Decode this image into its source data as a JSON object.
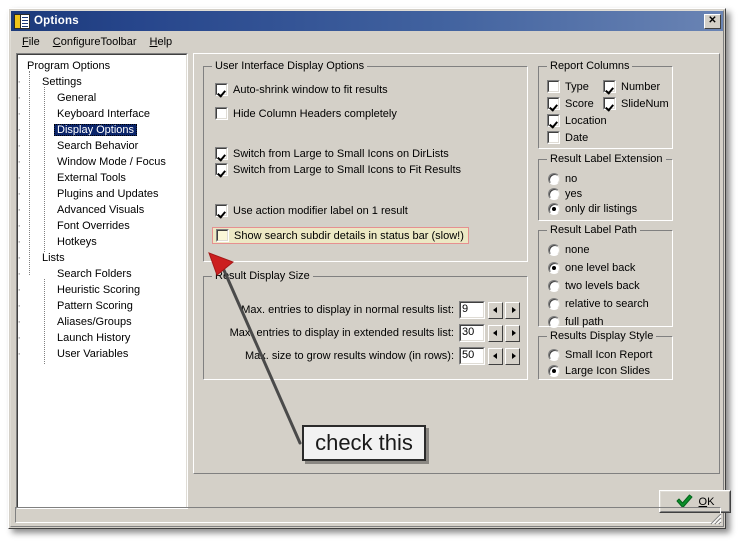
{
  "window": {
    "title": "Options",
    "icon": "options-checklist-icon",
    "close_label": "✕"
  },
  "menubar": {
    "items": [
      {
        "label": "File",
        "mnemonic": "F"
      },
      {
        "label": "ConfigureToolbar",
        "mnemonic": "C"
      },
      {
        "label": "Help",
        "mnemonic": "H"
      }
    ]
  },
  "tree": {
    "nodes": [
      {
        "label": "Program Options",
        "level": 0,
        "selected": false
      },
      {
        "label": "Settings",
        "level": 1,
        "selected": false
      },
      {
        "label": "General",
        "level": 2,
        "selected": false
      },
      {
        "label": "Keyboard Interface",
        "level": 2,
        "selected": false
      },
      {
        "label": "Display Options",
        "level": 2,
        "selected": true
      },
      {
        "label": "Search Behavior",
        "level": 2,
        "selected": false
      },
      {
        "label": "Window Mode / Focus",
        "level": 2,
        "selected": false
      },
      {
        "label": "External Tools",
        "level": 2,
        "selected": false
      },
      {
        "label": "Plugins and Updates",
        "level": 2,
        "selected": false
      },
      {
        "label": "Advanced Visuals",
        "level": 2,
        "selected": false
      },
      {
        "label": "Font Overrides",
        "level": 2,
        "selected": false
      },
      {
        "label": "Hotkeys",
        "level": 2,
        "selected": false
      },
      {
        "label": "Lists",
        "level": 1,
        "selected": false
      },
      {
        "label": "Search Folders",
        "level": 2,
        "selected": false
      },
      {
        "label": "Heuristic Scoring",
        "level": 2,
        "selected": false
      },
      {
        "label": "Pattern Scoring",
        "level": 2,
        "selected": false
      },
      {
        "label": "Aliases/Groups",
        "level": 2,
        "selected": false
      },
      {
        "label": "Launch History",
        "level": 2,
        "selected": false
      },
      {
        "label": "User Variables",
        "level": 2,
        "selected": false
      }
    ]
  },
  "ui_display_options": {
    "title": "User Interface Display Options",
    "checkboxes": [
      {
        "label": "Auto-shrink window to fit results",
        "checked": true
      },
      {
        "label": "Hide Column Headers completely",
        "checked": false
      },
      {
        "label": "Switch from Large to Small Icons on DirLists",
        "checked": true
      },
      {
        "label": "Switch from Large to Small Icons to Fit Results",
        "checked": true
      },
      {
        "label": "Use action modifier label on 1 result",
        "checked": true
      },
      {
        "label": "Show search subdir details in status bar (slow!)",
        "checked": false
      }
    ]
  },
  "result_display_size": {
    "title": "Result Display Size",
    "rows": [
      {
        "label": "Max. entries to display in normal results list:",
        "value": "9"
      },
      {
        "label": "Max. entries to display in extended results list:",
        "value": "30"
      },
      {
        "label": "Max. size to grow results window (in rows):",
        "value": "50"
      }
    ]
  },
  "report_columns": {
    "title": "Report Columns",
    "checkboxes": [
      {
        "label": "Type",
        "checked": false
      },
      {
        "label": "Number",
        "checked": true
      },
      {
        "label": "Score",
        "checked": true
      },
      {
        "label": "SlideNum",
        "checked": true
      },
      {
        "label": "Location",
        "checked": true
      },
      {
        "label": "Date",
        "checked": false
      }
    ]
  },
  "result_label_extension": {
    "title": "Result Label Extension",
    "options": [
      {
        "label": "no",
        "selected": false
      },
      {
        "label": "yes",
        "selected": false
      },
      {
        "label": "only dir listings",
        "selected": true
      }
    ]
  },
  "result_label_path": {
    "title": "Result Label Path",
    "options": [
      {
        "label": "none",
        "selected": false
      },
      {
        "label": "one level back",
        "selected": true
      },
      {
        "label": "two levels back",
        "selected": false
      },
      {
        "label": "relative to search",
        "selected": false
      },
      {
        "label": "full path",
        "selected": false
      }
    ]
  },
  "results_display_style": {
    "title": "Results Display Style",
    "options": [
      {
        "label": "Small Icon Report",
        "selected": false
      },
      {
        "label": "Large Icon Slides",
        "selected": true
      }
    ]
  },
  "buttons": {
    "ok_label": "OK",
    "ok_mnemonic": "O"
  },
  "annotation": {
    "callout_text": "check this",
    "arrow_color": "#cc1f1f",
    "line_color": "#4a4a4a"
  },
  "colors": {
    "face": "#d4d0c8",
    "title_gradient_start": "#1c3a7a",
    "title_gradient_end": "#6a84b4",
    "selection": "#0a246a",
    "highlight_fill": "#ece8c4",
    "highlight_border": "#e69090",
    "checkmark_green": "#0a8f2a"
  }
}
